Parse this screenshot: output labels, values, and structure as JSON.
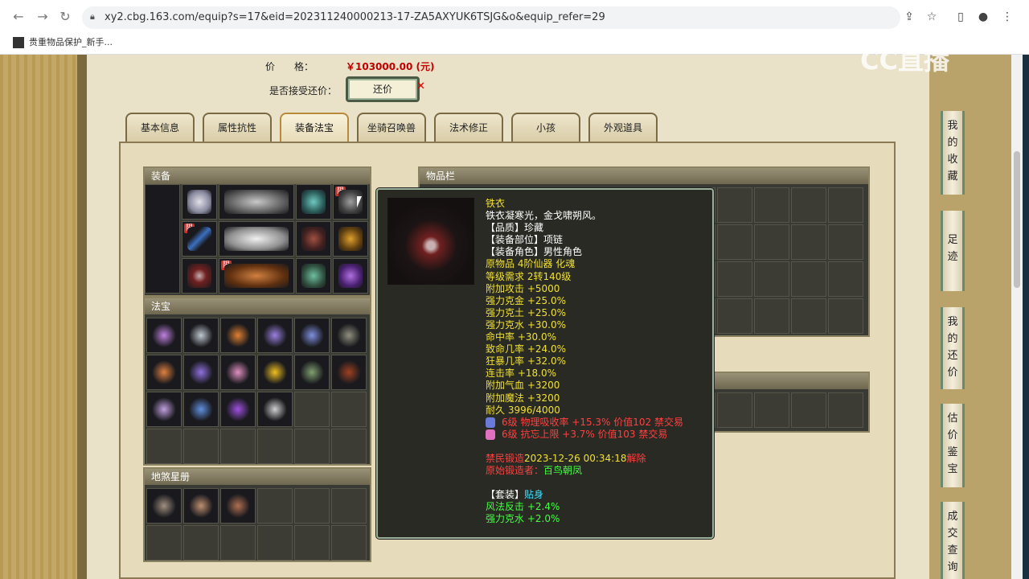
{
  "browser": {
    "url": "xy2.cbg.163.com/equip?s=17&eid=202311240000213-17-ZA5AXYUK6TSJG&o&equip_refer=29",
    "bookmark": "贵重物品保护_新手..."
  },
  "price": {
    "label": "价　　格：",
    "value": "￥103000.00 (元)"
  },
  "bargain": {
    "label": "是否接受还价：",
    "button": "还价"
  },
  "tabs": [
    "基本信息",
    "属性抗性",
    "装备法宝",
    "坐骑召唤兽",
    "法术修正",
    "小孩",
    "外观道具"
  ],
  "sections": {
    "equipment": "装备",
    "fabao": "法宝",
    "disha": "地煞星册",
    "inventory": "物品栏",
    "limited_badge": "限"
  },
  "tooltip": {
    "name": "铁衣",
    "desc": "铁衣凝寒光，金戈啸朔风。",
    "quality": "【品质】珍藏",
    "slot": "【装备部位】项链",
    "role": "【装备角色】男性角色",
    "origin": "原物品 4阶仙器 化魂",
    "level": "等级需求 2转140级",
    "stats": [
      "附加攻击 +5000",
      "强力克金 +25.0%",
      "强力克土 +25.0%",
      "强力克水 +30.0%",
      "命中率 +30.0%",
      "致命几率 +24.0%",
      "狂暴几率 +32.0%",
      "连击率 +18.0%",
      "附加气血 +3200",
      "附加魔法 +3200",
      "耐久 3996/4000"
    ],
    "gems": [
      {
        "text": "6级 物理吸收率 +15.3% 价值102 禁交易",
        "color": "#6a7ad8"
      },
      {
        "text": "6级 抗忘上限 +3.7% 价值103 禁交易",
        "color": "#e070c0"
      }
    ],
    "forge_prefix": "禁民锻造",
    "forge_time": "2023-12-26 00:34:18",
    "forge_suffix": "解除",
    "maker_label": "原始锻造者：",
    "maker": "百鸟朝凤",
    "set_label": "【套装】",
    "set_name": "贴身",
    "set_bonus": [
      "风法反击 +2.4%",
      "强力克水 +2.0%"
    ]
  },
  "sidebar": [
    {
      "label": "我的收藏"
    },
    {
      "label": "足迹"
    },
    {
      "label": "我的还价"
    },
    {
      "label": "估价鉴宝"
    },
    {
      "label": "成交查询"
    }
  ],
  "watermark": "CC直播"
}
